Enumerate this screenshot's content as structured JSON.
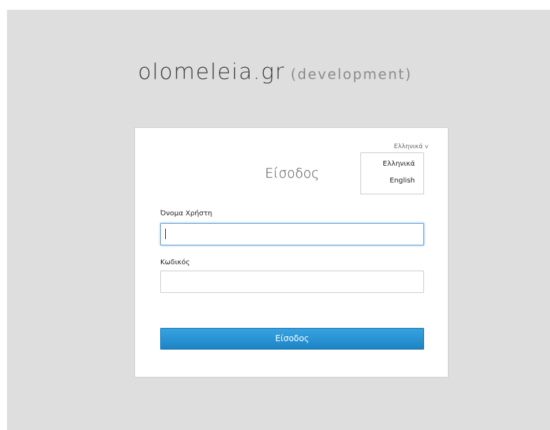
{
  "brand": {
    "name": "olomeleia.gr",
    "env": "(development)"
  },
  "login": {
    "title": "Είσοδος",
    "username_label": "Όνομα Χρήστη",
    "username_value": "",
    "password_label": "Κωδικός",
    "password_value": "",
    "submit_label": "Είσοδος"
  },
  "language": {
    "current": "Ελληνικά",
    "options": [
      "Ελληνικά",
      "English"
    ]
  },
  "colors": {
    "background": "#dedede",
    "accent": "#1d84c6",
    "focus": "#5b9dd9"
  }
}
